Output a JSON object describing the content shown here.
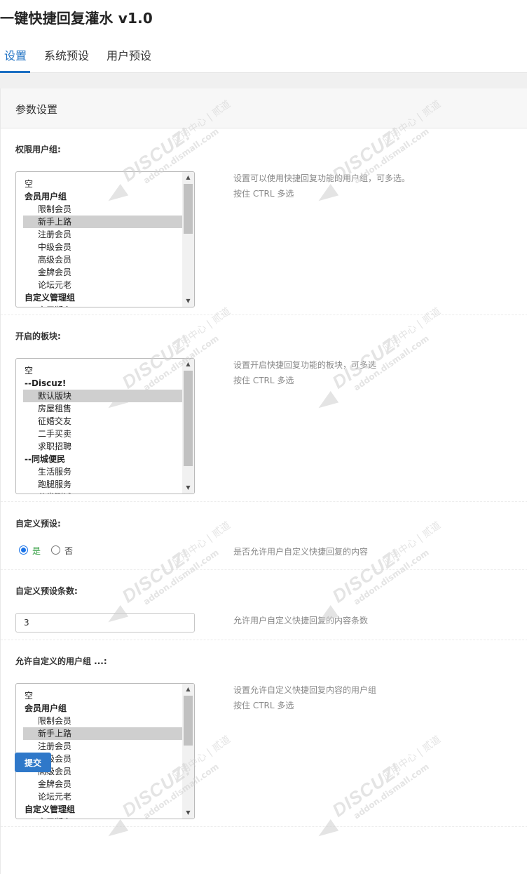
{
  "page": {
    "title": "一键快捷回复灌水 v1.0"
  },
  "tabs": [
    {
      "label": "设置",
      "active": true
    },
    {
      "label": "系统预设",
      "active": false
    },
    {
      "label": "用户预设",
      "active": false
    }
  ],
  "panel": {
    "title": "参数设置"
  },
  "sections": {
    "permission_groups": {
      "label": "权限用户组:",
      "help": "设置可以使用快捷回复功能的用户组，可多选。",
      "help2": "按住 CTRL 多选",
      "options": [
        {
          "text": "空",
          "kind": "plain"
        },
        {
          "text": "会员用户组",
          "kind": "group"
        },
        {
          "text": "限制会员",
          "kind": "child"
        },
        {
          "text": "新手上路",
          "kind": "child",
          "selected": true
        },
        {
          "text": "注册会员",
          "kind": "child"
        },
        {
          "text": "中级会员",
          "kind": "child"
        },
        {
          "text": "高级会员",
          "kind": "child"
        },
        {
          "text": "金牌会员",
          "kind": "child"
        },
        {
          "text": "论坛元老",
          "kind": "child"
        },
        {
          "text": "自定义管理组",
          "kind": "group"
        },
        {
          "text": "实习版主",
          "kind": "child"
        }
      ]
    },
    "forums": {
      "label": "开启的板块:",
      "help": "设置开启快捷回复功能的板块，可多选",
      "help2": "按住 CTRL 多选",
      "options": [
        {
          "text": "空",
          "kind": "plain"
        },
        {
          "text": "--Discuz!",
          "kind": "group"
        },
        {
          "text": "默认版块",
          "kind": "child",
          "selected": true
        },
        {
          "text": "房屋租售",
          "kind": "child"
        },
        {
          "text": "征婚交友",
          "kind": "child"
        },
        {
          "text": "二手买卖",
          "kind": "child"
        },
        {
          "text": "求职招聘",
          "kind": "child"
        },
        {
          "text": "--同城便民",
          "kind": "group"
        },
        {
          "text": "生活服务",
          "kind": "child"
        },
        {
          "text": "跑腿服务",
          "kind": "child"
        },
        {
          "text": "分类测试",
          "kind": "child"
        }
      ]
    },
    "custom_preset": {
      "label": "自定义预设:",
      "yes_label": "是",
      "no_label": "否",
      "value": "yes",
      "help": "是否允许用户自定义快捷回复的内容"
    },
    "custom_count": {
      "label": "自定义预设条数:",
      "value": "3",
      "help": "允许用户自定义快捷回复的内容条数"
    },
    "custom_groups": {
      "label": "允许自定义的用户组 ...:",
      "help": "设置允许自定义快捷回复内容的用户组",
      "help2": "按住 CTRL 多选",
      "options": [
        {
          "text": "空",
          "kind": "plain"
        },
        {
          "text": "会员用户组",
          "kind": "group"
        },
        {
          "text": "限制会员",
          "kind": "child"
        },
        {
          "text": "新手上路",
          "kind": "child",
          "selected": true
        },
        {
          "text": "注册会员",
          "kind": "child"
        },
        {
          "text": "中级会员",
          "kind": "child"
        },
        {
          "text": "高级会员",
          "kind": "child"
        },
        {
          "text": "金牌会员",
          "kind": "child"
        },
        {
          "text": "论坛元老",
          "kind": "child"
        },
        {
          "text": "自定义管理组",
          "kind": "group"
        },
        {
          "text": "实习版主",
          "kind": "child"
        }
      ]
    }
  },
  "submit_label": "提交",
  "watermark": {
    "logo": "DISCUZ!",
    "cn": "应用中心 | 贰道",
    "sub": "addon.dismall.com"
  },
  "colors": {
    "accent": "#1b6fc2",
    "button": "#2f78c9",
    "radio_yes": "#2a9a3a"
  }
}
